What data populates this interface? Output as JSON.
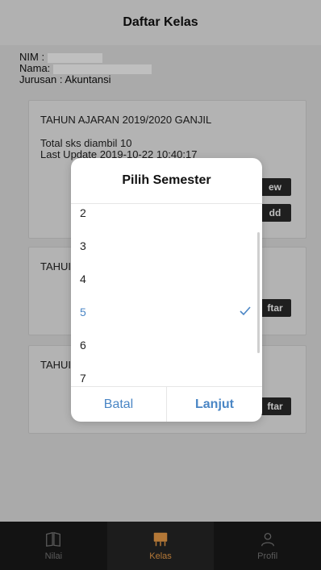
{
  "header": {
    "title": "Daftar Kelas"
  },
  "student": {
    "nim_label": "NIM :",
    "nama_label": "Nama:",
    "jurusan": "Jurusan : Akuntansi"
  },
  "cards": [
    {
      "title": "TAHUN AJARAN 2019/2020 GANJIL",
      "sks": "Total sks diambil 10",
      "updated": "Last Update 2019-10-22 10:40:17",
      "button1": "ew",
      "button2": "dd"
    },
    {
      "title": "TAHUI",
      "button": "ftar"
    },
    {
      "title": "TAHUI",
      "button": "ftar"
    }
  ],
  "dialog": {
    "title": "Pilih Semester",
    "options": [
      "2",
      "3",
      "4",
      "5",
      "6",
      "7"
    ],
    "selected": "5",
    "cancel": "Batal",
    "confirm": "Lanjut"
  },
  "tabs": [
    {
      "label": "Nilai",
      "icon": "book-icon"
    },
    {
      "label": "Kelas",
      "icon": "classroom-board-icon",
      "active": true
    },
    {
      "label": "Profil",
      "icon": "person-icon"
    }
  ],
  "colors": {
    "accent": "#4a86c5",
    "active_tab": "#f0a04a",
    "tabbar": "#1a1a1a"
  }
}
